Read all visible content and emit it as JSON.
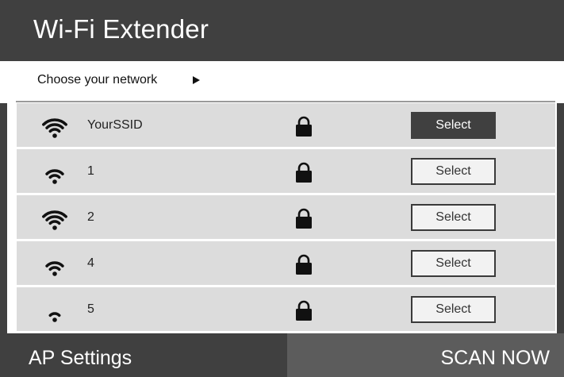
{
  "app": {
    "title": "Wi-Fi Extender"
  },
  "subheader": {
    "label": "Choose your network"
  },
  "networks": [
    {
      "ssid": "YourSSID",
      "signal": 4,
      "locked": true,
      "button_label": "Select",
      "button_state": "active"
    },
    {
      "ssid": "1",
      "signal": 3,
      "locked": true,
      "button_label": "Select",
      "button_state": "normal"
    },
    {
      "ssid": "2",
      "signal": 4,
      "locked": true,
      "button_label": "Select",
      "button_state": "normal"
    },
    {
      "ssid": "4",
      "signal": 3,
      "locked": true,
      "button_label": "Select",
      "button_state": "normal"
    },
    {
      "ssid": "5",
      "signal": 2,
      "locked": true,
      "button_label": "Select",
      "button_state": "normal"
    }
  ],
  "footer": {
    "ap_settings_label": "AP Settings",
    "scan_label": "SCAN NOW"
  },
  "colors": {
    "header_bg": "#404040",
    "row_bg": "#dcdcdc",
    "button_active_bg": "#404040",
    "scan_bg": "#5c5c5c"
  },
  "icons": {
    "signal": "wifi-signal-icon",
    "lock": "lock-icon",
    "arrow": "right-arrow-icon"
  }
}
